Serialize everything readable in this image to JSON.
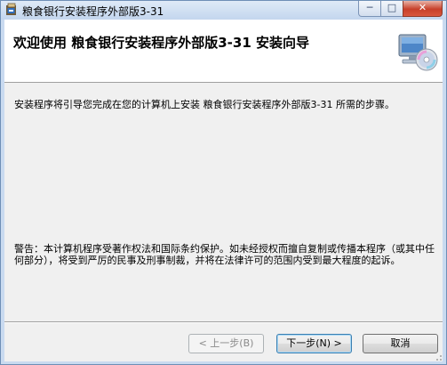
{
  "window": {
    "title": "粮食银行安装程序外部版3-31",
    "icons": {
      "app": "installer-app-icon",
      "minimize": "minimize-icon",
      "maximize": "maximize-icon",
      "close": "close-icon"
    },
    "controls": {
      "minimize": "─",
      "maximize": "□",
      "close": "✕"
    }
  },
  "banner": {
    "title": "欢迎使用 粮食银行安装程序外部版3-31 安装向导",
    "icon": "computer-cd-icon"
  },
  "body": {
    "intro": "安装程序将引导您完成在您的计算机上安装 粮食银行安装程序外部版3-31 所需的步骤。",
    "warning": "警告：本计算机程序受著作权法和国际条约保护。如未经授权而擅自复制或传播本程序（或其中任何部分），将受到严厉的民事及刑事制裁，并将在法律许可的范围内受到最大程度的起诉。"
  },
  "buttons": {
    "back": "< 上一步(B)",
    "next": "下一步(N) >",
    "cancel": "取消"
  },
  "colors": {
    "titlebar": "#c9daf0",
    "banner_bg": "#ffffff",
    "dialog_bg": "#f0f0f0",
    "close_red": "#c7402a"
  }
}
